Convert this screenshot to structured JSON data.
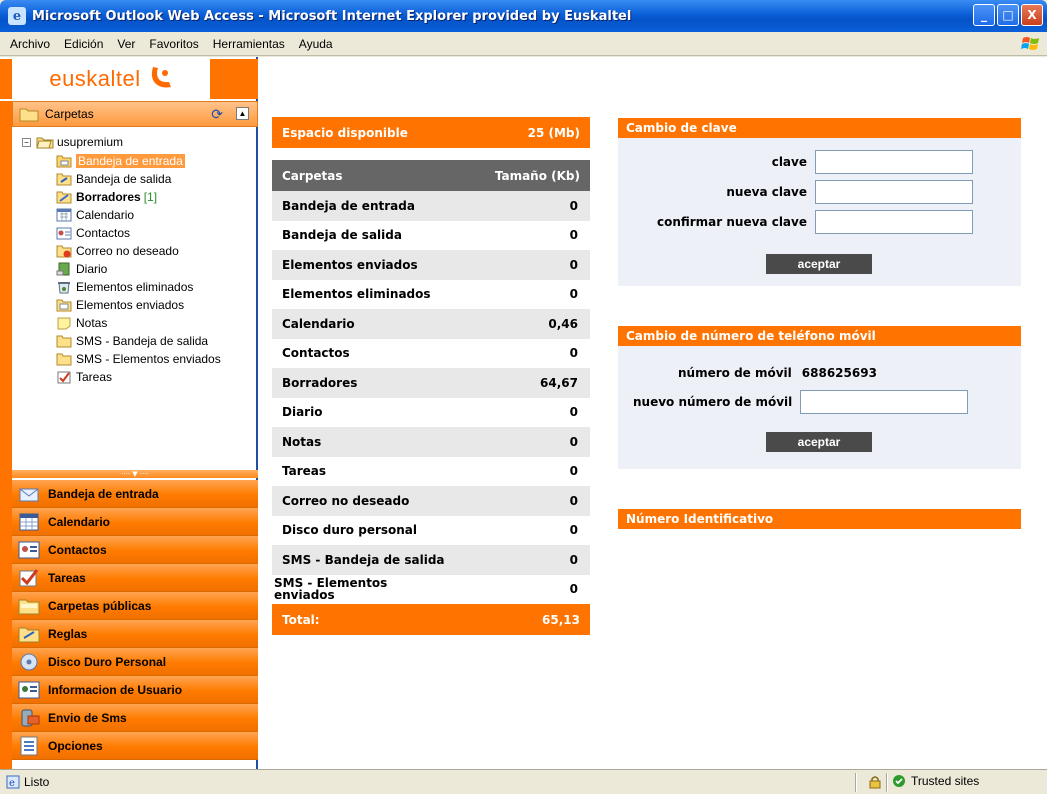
{
  "window": {
    "title": "Microsoft Outlook Web Access - Microsoft Internet Explorer provided by Euskaltel",
    "minimize": "_",
    "maximize": "□",
    "close": "X"
  },
  "menu": [
    "Archivo",
    "Edición",
    "Ver",
    "Favoritos",
    "Herramientas",
    "Ayuda"
  ],
  "logo": {
    "text": "euskaltel"
  },
  "folders_pane": {
    "header": "Carpetas",
    "root": "usupremium",
    "items": [
      {
        "label": "Bandeja de entrada",
        "icon": "inbox-folder-icon",
        "selected": true
      },
      {
        "label": "Bandeja de salida",
        "icon": "outbox-folder-icon"
      },
      {
        "label": "Borradores",
        "icon": "drafts-folder-icon",
        "bold": true,
        "count": "[1]"
      },
      {
        "label": "Calendario",
        "icon": "calendar-icon"
      },
      {
        "label": "Contactos",
        "icon": "contacts-icon"
      },
      {
        "label": "Correo no deseado",
        "icon": "junk-mail-icon"
      },
      {
        "label": "Diario",
        "icon": "journal-icon"
      },
      {
        "label": "Elementos eliminados",
        "icon": "deleted-items-icon"
      },
      {
        "label": "Elementos enviados",
        "icon": "sent-items-icon"
      },
      {
        "label": "Notas",
        "icon": "notes-icon"
      },
      {
        "label": "SMS - Bandeja de salida",
        "icon": "folder-icon"
      },
      {
        "label": "SMS - Elementos enviados",
        "icon": "folder-icon"
      },
      {
        "label": "Tareas",
        "icon": "tasks-icon"
      }
    ]
  },
  "nav": [
    {
      "label": "Bandeja de entrada",
      "icon": "inbox-icon"
    },
    {
      "label": "Calendario",
      "icon": "calendar-icon"
    },
    {
      "label": "Contactos",
      "icon": "contacts-icon"
    },
    {
      "label": "Tareas",
      "icon": "tasks-icon"
    },
    {
      "label": "Carpetas públicas",
      "icon": "public-folders-icon"
    },
    {
      "label": "Reglas",
      "icon": "rules-icon"
    },
    {
      "label": "Disco Duro Personal",
      "icon": "hard-disk-icon"
    },
    {
      "label": "Informacion de Usuario",
      "icon": "user-info-icon"
    },
    {
      "label": "Envio de Sms",
      "icon": "sms-icon"
    },
    {
      "label": "Opciones",
      "icon": "options-icon"
    }
  ],
  "quota": {
    "label": "Espacio disponible",
    "value": "25 (Mb)"
  },
  "folder_table": {
    "col_folder": "Carpetas",
    "col_size": "Tamaño (Kb)",
    "rows": [
      {
        "name": "Bandeja de entrada",
        "size": "0"
      },
      {
        "name": "Bandeja de salida",
        "size": "0"
      },
      {
        "name": "Elementos enviados",
        "size": "0"
      },
      {
        "name": "Elementos eliminados",
        "size": "0"
      },
      {
        "name": "Calendario",
        "size": "0,46"
      },
      {
        "name": "Contactos",
        "size": "0"
      },
      {
        "name": "Borradores",
        "size": "64,67"
      },
      {
        "name": "Diario",
        "size": "0"
      },
      {
        "name": "Notas",
        "size": "0"
      },
      {
        "name": "Tareas",
        "size": "0"
      },
      {
        "name": "Correo no deseado",
        "size": "0"
      },
      {
        "name": "Disco duro personal",
        "size": "0"
      },
      {
        "name": "SMS - Bandeja de salida",
        "size": "0"
      },
      {
        "name": "SMS - Elementos enviados",
        "size": "0"
      }
    ],
    "total_label": "Total:",
    "total_value": "65,13"
  },
  "password_panel": {
    "title": "Cambio de clave",
    "field_current": "clave",
    "field_new": "nueva clave",
    "field_confirm": "confirmar nueva clave",
    "button": "aceptar"
  },
  "mobile_panel": {
    "title": "Cambio de número de teléfono móvil",
    "current_label": "número de móvil",
    "current_value": "688625693",
    "new_label": "nuevo número de móvil",
    "button": "aceptar"
  },
  "id_panel": {
    "title": "Número Identificativo"
  },
  "status": {
    "text": "Listo",
    "zone": "Trusted sites"
  },
  "colors": {
    "accent": "#ff7400",
    "table_header": "#666666",
    "button": "#4a4a4a"
  }
}
